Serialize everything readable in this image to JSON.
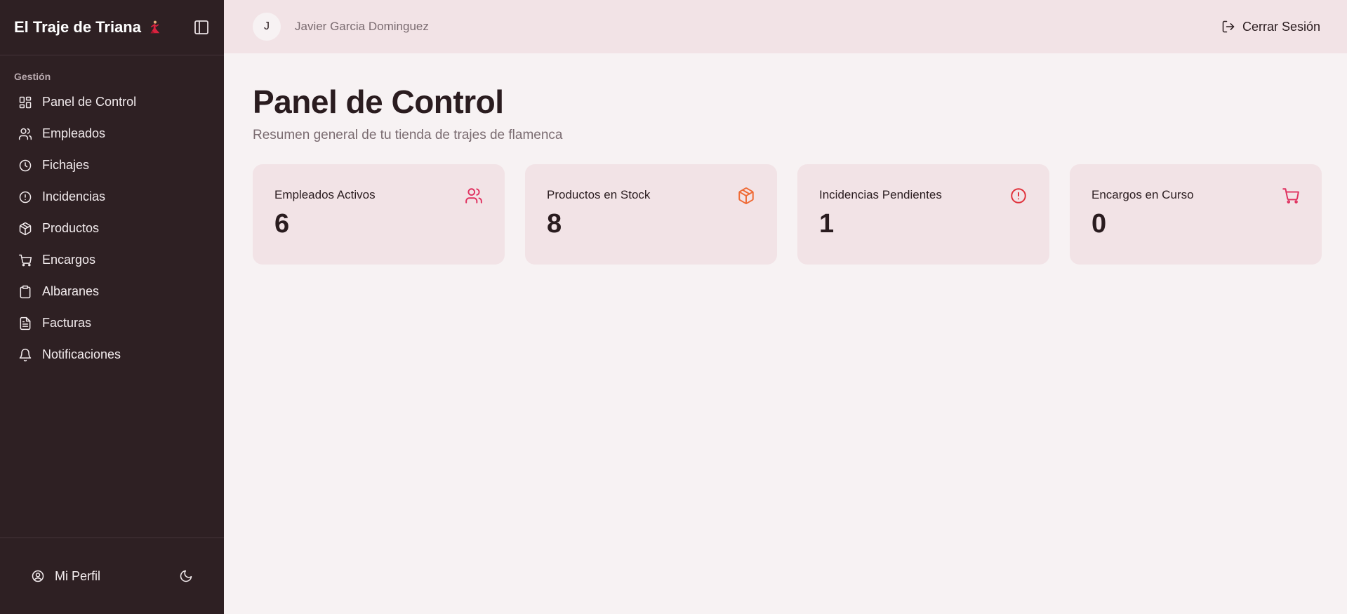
{
  "brand": {
    "title": "El Traje de Triana"
  },
  "sidebar": {
    "section_label": "Gestión",
    "items": [
      {
        "label": "Panel de Control",
        "icon": "dashboard-icon"
      },
      {
        "label": "Empleados",
        "icon": "users-icon"
      },
      {
        "label": "Fichajes",
        "icon": "clock-icon"
      },
      {
        "label": "Incidencias",
        "icon": "alert-circle-icon"
      },
      {
        "label": "Productos",
        "icon": "package-icon"
      },
      {
        "label": "Encargos",
        "icon": "cart-icon"
      },
      {
        "label": "Albaranes",
        "icon": "clipboard-icon"
      },
      {
        "label": "Facturas",
        "icon": "file-text-icon"
      },
      {
        "label": "Notificaciones",
        "icon": "bell-icon"
      }
    ],
    "footer": {
      "profile_label": "Mi Perfil"
    }
  },
  "topbar": {
    "avatar_initial": "J",
    "user_name": "Javier Garcia Dominguez",
    "logout_label": "Cerrar Sesión"
  },
  "main": {
    "title": "Panel de Control",
    "subtitle": "Resumen general de tu tienda de trajes de flamenca",
    "cards": [
      {
        "label": "Empleados Activos",
        "value": "6",
        "icon": "users-icon",
        "color": "#e0305f"
      },
      {
        "label": "Productos en Stock",
        "value": "8",
        "icon": "package-icon",
        "color": "#ef6a35"
      },
      {
        "label": "Incidencias Pendientes",
        "value": "1",
        "icon": "alert-circle-icon",
        "color": "#e0303a"
      },
      {
        "label": "Encargos en Curso",
        "value": "0",
        "icon": "cart-icon",
        "color": "#e0305f"
      }
    ]
  },
  "colors": {
    "sidebar_bg": "#2e2023",
    "topbar_bg": "#f2e3e6",
    "page_bg": "#f7f2f3",
    "card_bg": "#f2e3e6",
    "accent": "#e0305f"
  }
}
